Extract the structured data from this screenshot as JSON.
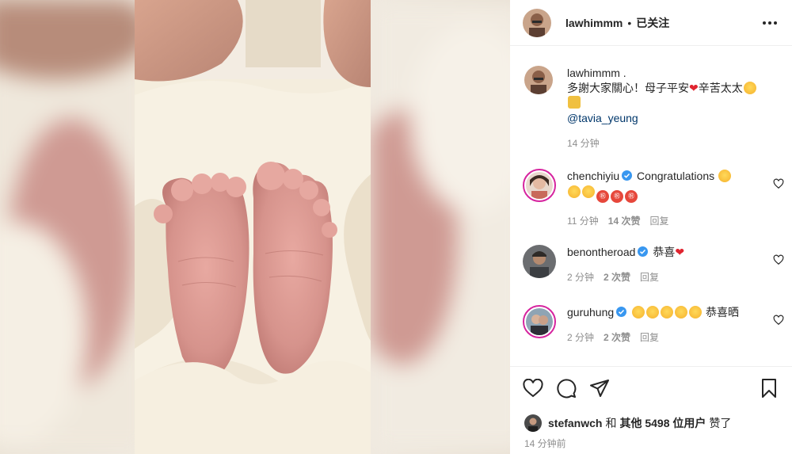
{
  "header": {
    "username": "lawhimmm",
    "separator": "•",
    "follow_status": "已关注",
    "more_icon": "more-horizontal-icon"
  },
  "caption": {
    "username": "lawhimmm",
    "suffix": ".",
    "text": "多謝大家關心！母子平安",
    "text2": "辛苦太太",
    "mention": "@tavia_yeung",
    "time": "14 分钟"
  },
  "comments": [
    {
      "username": "chenchiyiu",
      "verified": true,
      "text": "Congratulations",
      "time": "11 分钟",
      "likes": "14 次赞",
      "reply": "回复"
    },
    {
      "username": "benontheroad",
      "verified": true,
      "text": "恭喜",
      "time": "2 分钟",
      "likes": "2 次赞",
      "reply": "回复"
    },
    {
      "username": "guruhung",
      "verified": true,
      "text": "恭喜晒",
      "time": "2 分钟",
      "likes": "2 次赞",
      "reply": "回复"
    }
  ],
  "likes": {
    "liker": "stefanwch",
    "and": "和",
    "others": "其他 5498 位用户",
    "liked": "赞了"
  },
  "posted": "14 分钟前",
  "colors": {
    "verified": "#3897f0",
    "heart": "#e0242f",
    "mention": "#00376b",
    "muted": "#8e8e8e"
  }
}
